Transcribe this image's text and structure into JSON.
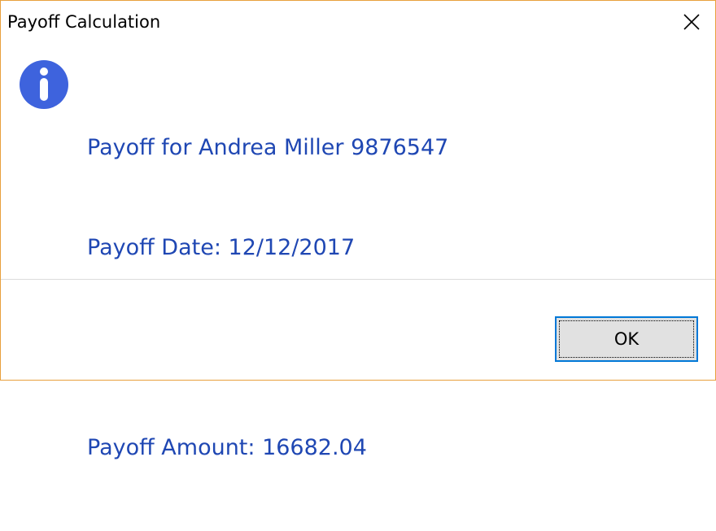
{
  "window": {
    "title": "Payoff Calculation"
  },
  "titlebar": {
    "close_icon": "close-icon"
  },
  "message": {
    "icon": "info-icon",
    "line1": "Payoff for Andrea Miller 9876547",
    "line2": "Payoff Date: 12/12/2017",
    "line3": "",
    "line4": "Payoff Amount: 16682.04"
  },
  "buttons": {
    "ok_label": "OK"
  },
  "colors": {
    "border_accent": "#e8a03c",
    "message_text": "#1f47b3",
    "info_icon_fill": "#3e63dd",
    "button_focus": "#0078d7"
  }
}
